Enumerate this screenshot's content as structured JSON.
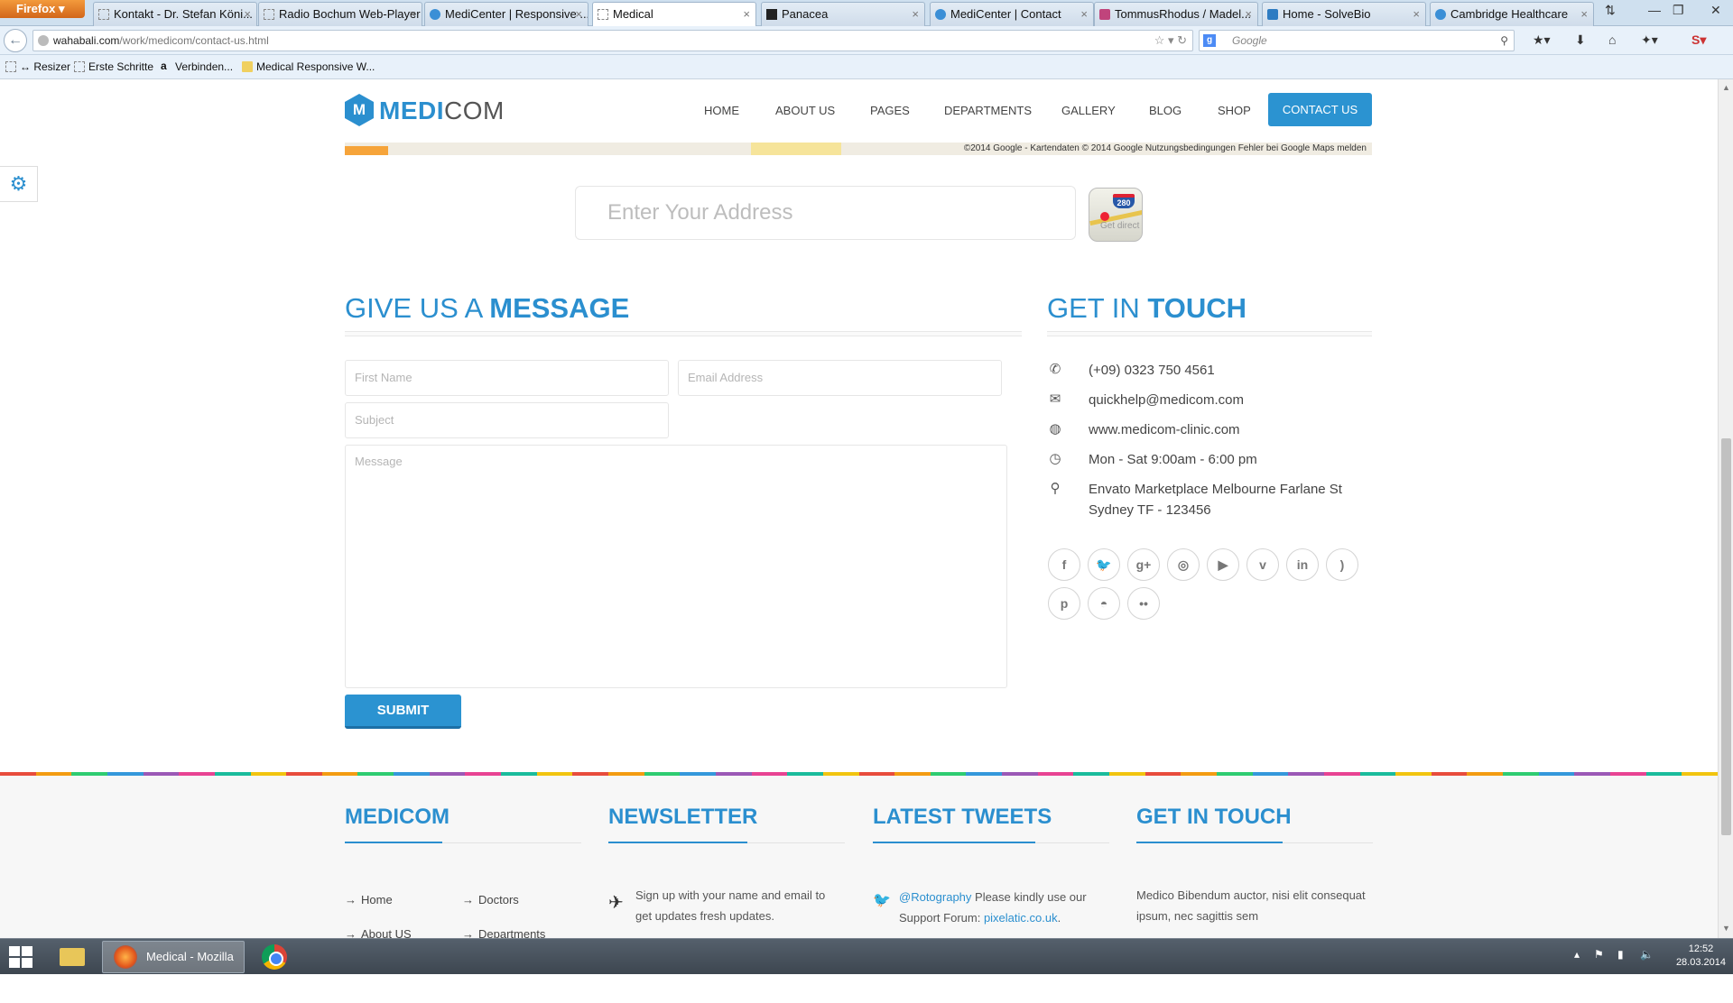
{
  "browser": {
    "menu_button": "Firefox ▾",
    "tabs": [
      {
        "label": "Kontakt - Dr. Stefan Köni...",
        "icon": "dashed-page-icon",
        "active": false
      },
      {
        "label": "Radio Bochum Web-Player",
        "icon": "dashed-page-icon",
        "active": false
      },
      {
        "label": "MediCenter | Responsive ...",
        "icon": "medicenter-favicon",
        "active": false
      },
      {
        "label": "Medical",
        "icon": "dashed-page-icon",
        "active": true
      },
      {
        "label": "Panacea",
        "icon": "panacea-favicon",
        "active": false
      },
      {
        "label": "MediCenter | Contact",
        "icon": "medicenter-favicon",
        "active": false
      },
      {
        "label": "TommusRhodus / Madel...",
        "icon": "tommus-favicon",
        "active": false
      },
      {
        "label": "Home - SolveBio",
        "icon": "solvebio-favicon",
        "active": false
      },
      {
        "label": "Cambridge Healthcare",
        "icon": "cambridge-favicon",
        "active": false
      }
    ],
    "tab_close": "×",
    "url_domain": "wahabali.com",
    "url_path": "/work/medicom/contact-us.html",
    "search_placeholder": "Google",
    "search_engine_glyph": "g",
    "bookmarks": [
      {
        "label": "↔ Resizer",
        "icon": "dashed-page-icon"
      },
      {
        "label": "Erste Schritte",
        "icon": "dashed-page-icon"
      },
      {
        "label": "Verbinden...",
        "icon": "amazon-icon"
      },
      {
        "label": "Medical Responsive W...",
        "icon": "folder-icon"
      }
    ]
  },
  "site": {
    "logo_hex_letter": "M",
    "logo_part1": "MEDI",
    "logo_part2": "COM",
    "menu": [
      "HOME",
      "ABOUT US",
      "PAGES",
      "DEPARTMENTS",
      "GALLERY",
      "BLOG",
      "SHOP"
    ],
    "menu_cta": "CONTACT US",
    "map_credit": "©2014 Google - Kartendaten © 2014 Google    Nutzungsbedingungen    Fehler bei Google Maps melden",
    "address_placeholder": "Enter Your Address",
    "directions_shield": "280",
    "directions_text": "Get direct",
    "message_section": {
      "title_light": "GIVE US A ",
      "title_bold": "MESSAGE"
    },
    "form": {
      "first_name": "First Name",
      "email": "Email Address",
      "subject": "Subject",
      "message": "Message",
      "submit": "SUBMIT"
    },
    "touch_section": {
      "title_light": "GET IN ",
      "title_bold": "TOUCH"
    },
    "contact_info": [
      {
        "icon": "phone-icon",
        "glyph": "✆",
        "text": "(+09) 0323 750 4561"
      },
      {
        "icon": "envelope-icon",
        "glyph": "✉",
        "text": "quickhelp@medicom.com"
      },
      {
        "icon": "globe-icon",
        "glyph": "◍",
        "text": "www.medicom-clinic.com"
      },
      {
        "icon": "clock-icon",
        "glyph": "◷",
        "text": "Mon - Sat 9:00am - 6:00 pm"
      },
      {
        "icon": "map-pin-icon",
        "glyph": "⚲",
        "text_line1": "Envato Marketplace Melbourne Farlane St",
        "text_line2": "Sydney TF - 123456"
      }
    ],
    "social": [
      {
        "name": "facebook-icon",
        "glyph": "f"
      },
      {
        "name": "twitter-icon",
        "glyph": "🐦"
      },
      {
        "name": "google-plus-icon",
        "glyph": "g+"
      },
      {
        "name": "dribbble-icon",
        "glyph": "◎"
      },
      {
        "name": "youtube-icon",
        "glyph": "▶"
      },
      {
        "name": "vimeo-icon",
        "glyph": "v"
      },
      {
        "name": "linkedin-icon",
        "glyph": "in"
      },
      {
        "name": "rss-icon",
        "glyph": ")"
      },
      {
        "name": "pinterest-icon",
        "glyph": "p"
      },
      {
        "name": "android-icon",
        "glyph": "◓"
      },
      {
        "name": "flickr-icon",
        "glyph": "••"
      }
    ],
    "footer": {
      "col1_title": "MEDICOM",
      "col1_links": [
        "Home",
        "Doctors",
        "About US",
        "Departments"
      ],
      "col2_title": "NEWSLETTER",
      "col2_text_line1": "Sign up with your name and email to",
      "col2_text_line2": "get updates fresh updates.",
      "col3_title": "LATEST TWEETS",
      "col3_handle": "@Rotography",
      "col3_text_1": " Please kindly use our",
      "col3_text_2": "Support Forum: ",
      "col3_link": "pixelatic.co.uk",
      "col3_end": ".",
      "col4_title": "GET IN TOUCH",
      "col4_text_line1": "Medico Bibendum auctor, nisi elit consequat",
      "col4_text_line2": "ipsum, nec sagittis sem"
    }
  },
  "taskbar": {
    "firefox_label": "Medical - Mozilla ...",
    "time": "12:52",
    "date": "28.03.2014"
  },
  "colors": {
    "accent": "#2b8fcf",
    "button": "#2b93d1",
    "footer_bg": "#f7f7f7"
  }
}
